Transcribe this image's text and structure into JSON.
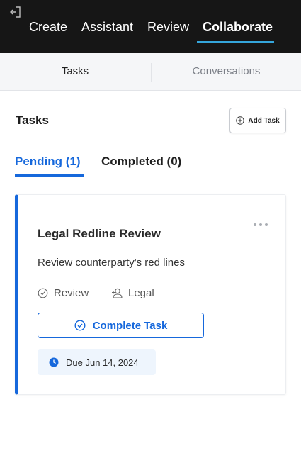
{
  "nav": {
    "tabs": [
      {
        "label": "Create"
      },
      {
        "label": "Assistant"
      },
      {
        "label": "Review"
      },
      {
        "label": "Collaborate"
      }
    ],
    "active": "Collaborate",
    "exit_icon": "exit-icon"
  },
  "subtabs": {
    "items": [
      {
        "label": "Tasks"
      },
      {
        "label": "Conversations"
      }
    ],
    "active": "Tasks"
  },
  "tasks_header": {
    "title": "Tasks",
    "add_button_label": "Add Task",
    "add_icon": "plus-circle-icon"
  },
  "status_tabs": {
    "pending_label": "Pending (1)",
    "completed_label": "Completed (0)",
    "active": "pending"
  },
  "task": {
    "title": "Legal Redline Review",
    "description": "Review counterparty's red lines",
    "status": "Review",
    "team": "Legal",
    "complete_button_label": "Complete Task",
    "due_label": "Due Jun 14, 2024"
  },
  "colors": {
    "accent": "#1668dc",
    "nav_bg": "#161616",
    "nav_underline": "#35a6dc",
    "due_bg": "#eef5fd"
  }
}
